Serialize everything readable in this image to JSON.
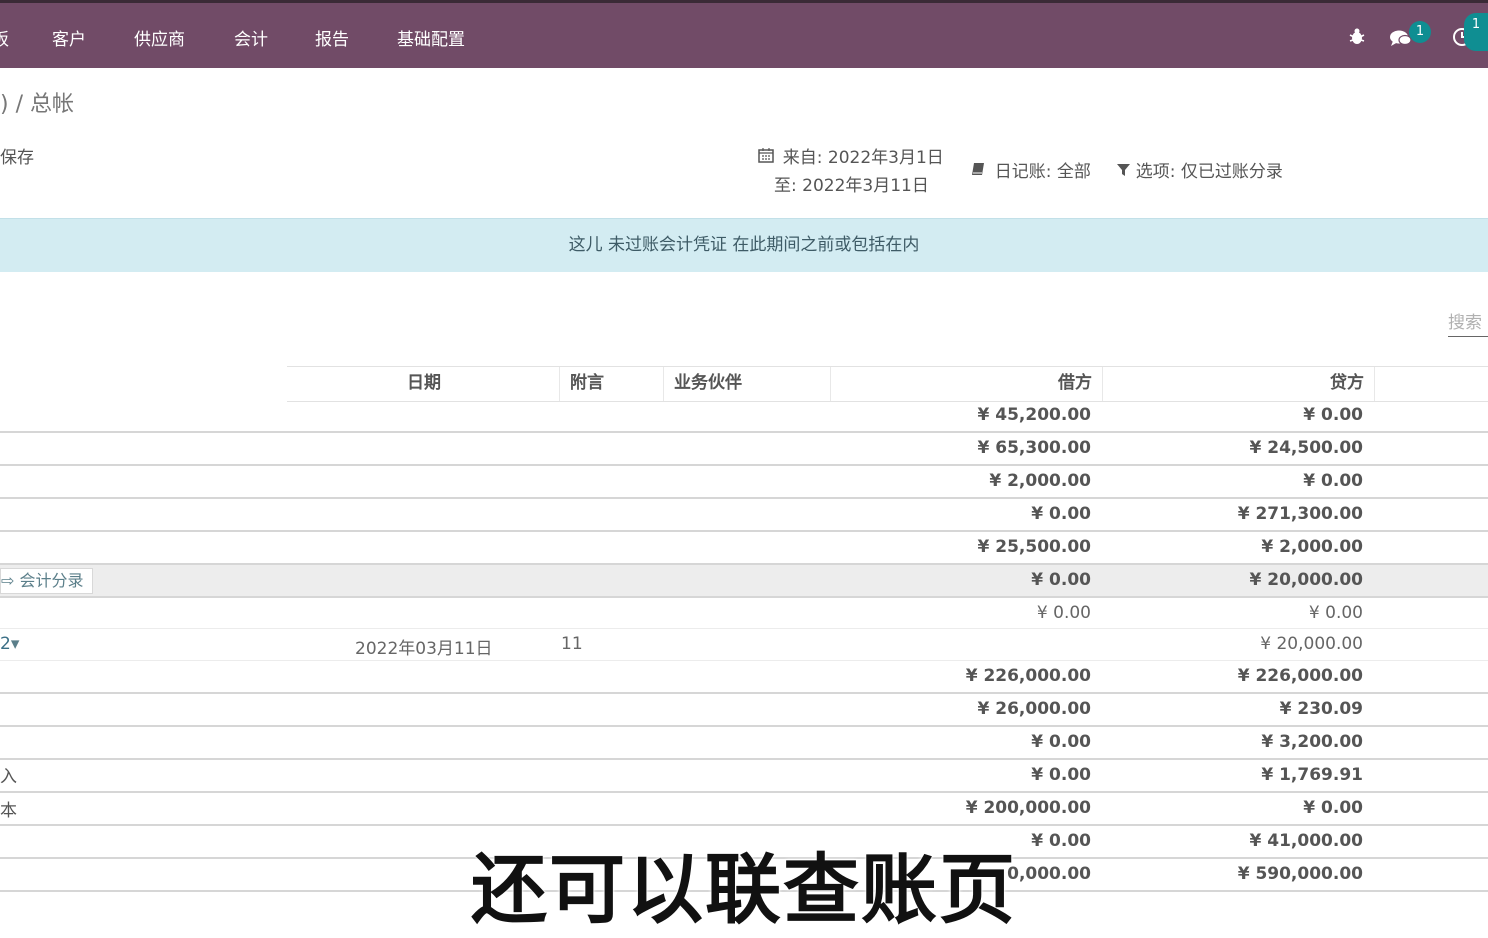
{
  "nav": {
    "items": [
      "板",
      "客户",
      "供应商",
      "会计",
      "报告",
      "基础配置"
    ],
    "chat_badge": "1",
    "activity_badge": "1"
  },
  "breadcrumb": ") / 总帐",
  "toolbar": {
    "save_label": "保存"
  },
  "filters": {
    "date_from": "来自: 2022年3月1日",
    "date_to": "至: 2022年3月11日",
    "journal": "日记账: 全部",
    "options": "选项: 仅已过账分录"
  },
  "notice": "这儿 未过账会计凭证 在此期间之前或包括在内",
  "search": {
    "placeholder": "搜索"
  },
  "table": {
    "headers": {
      "date": "日期",
      "ref": "附言",
      "partner": "业务伙伴",
      "debit": "借方",
      "credit": "贷方"
    },
    "rows": [
      {
        "account": "",
        "debit": "¥ 45,200.00",
        "credit": "¥ 0.00"
      },
      {
        "account": "",
        "debit": "¥ 65,300.00",
        "credit": "¥ 24,500.00"
      },
      {
        "account": "",
        "debit": "¥ 2,000.00",
        "credit": "¥ 0.00"
      },
      {
        "account": "",
        "debit": "¥ 0.00",
        "credit": "¥ 271,300.00"
      },
      {
        "account": "",
        "debit": "¥ 25,500.00",
        "credit": "¥ 2,000.00"
      },
      {
        "account": "会计分录",
        "debit": "¥ 0.00",
        "credit": "¥ 20,000.00"
      },
      {
        "account": "",
        "debit": "¥ 0.00",
        "credit": "¥ 0.00"
      },
      {
        "account": "2",
        "date": "2022年03月11日",
        "ref": "11",
        "debit": "",
        "credit": "¥ 20,000.00"
      },
      {
        "account": "",
        "debit": "¥ 226,000.00",
        "credit": "¥ 226,000.00"
      },
      {
        "account": "",
        "debit": "¥ 26,000.00",
        "credit": "¥ 230.09"
      },
      {
        "account": "",
        "debit": "¥ 0.00",
        "credit": "¥ 3,200.00"
      },
      {
        "account": "入",
        "debit": "¥ 0.00",
        "credit": "¥ 1,769.91"
      },
      {
        "account": "本",
        "debit": "¥ 200,000.00",
        "credit": "¥ 0.00"
      },
      {
        "account": "",
        "debit": "¥ 0.00",
        "credit": "¥ 41,000.00"
      },
      {
        "account": "",
        "debit": "0,000.00",
        "credit": "¥ 590,000.00"
      }
    ]
  },
  "subtitle": "还可以联查账页",
  "colors": {
    "nav_bg": "#714b67",
    "notice_bg": "#d3ecf2",
    "badge": "#0f8e92"
  }
}
